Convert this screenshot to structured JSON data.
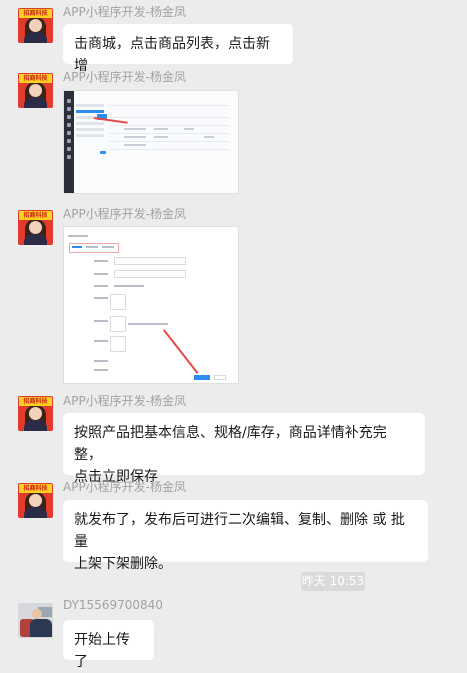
{
  "messages": [
    {
      "sender": "APP小程序开发-杨金凤",
      "type": "text",
      "text": "击商城，点击商品列表，点击新增",
      "avatar_badge": "招商科技"
    },
    {
      "sender": "APP小程序开发-杨金凤",
      "type": "image",
      "avatar_badge": "招商科技"
    },
    {
      "sender": "APP小程序开发-杨金凤",
      "type": "image",
      "avatar_badge": "招商科技"
    },
    {
      "sender": "APP小程序开发-杨金凤",
      "type": "text",
      "text_line1": "按照产品把基本信息、规格/库存，商品详情补充完整，",
      "text_line2": "点击立即保存",
      "avatar_badge": "招商科技"
    },
    {
      "sender": "APP小程序开发-杨金凤",
      "type": "text",
      "text_line1": "就发布了，发布后可进行二次编辑、复制、删除 或 批量",
      "text_line2": "上架下架删除。",
      "avatar_badge": "招商科技"
    },
    {
      "sender": "DY15569700840",
      "type": "text",
      "text": "开始上传了"
    }
  ],
  "timestamp": "昨天 10:53",
  "colors": {
    "background": "#ececec",
    "bubble": "#ffffff",
    "sender_name": "#a2a2a2",
    "accent_blue": "#2d8cf0",
    "annotation_red": "#e84a4a"
  }
}
